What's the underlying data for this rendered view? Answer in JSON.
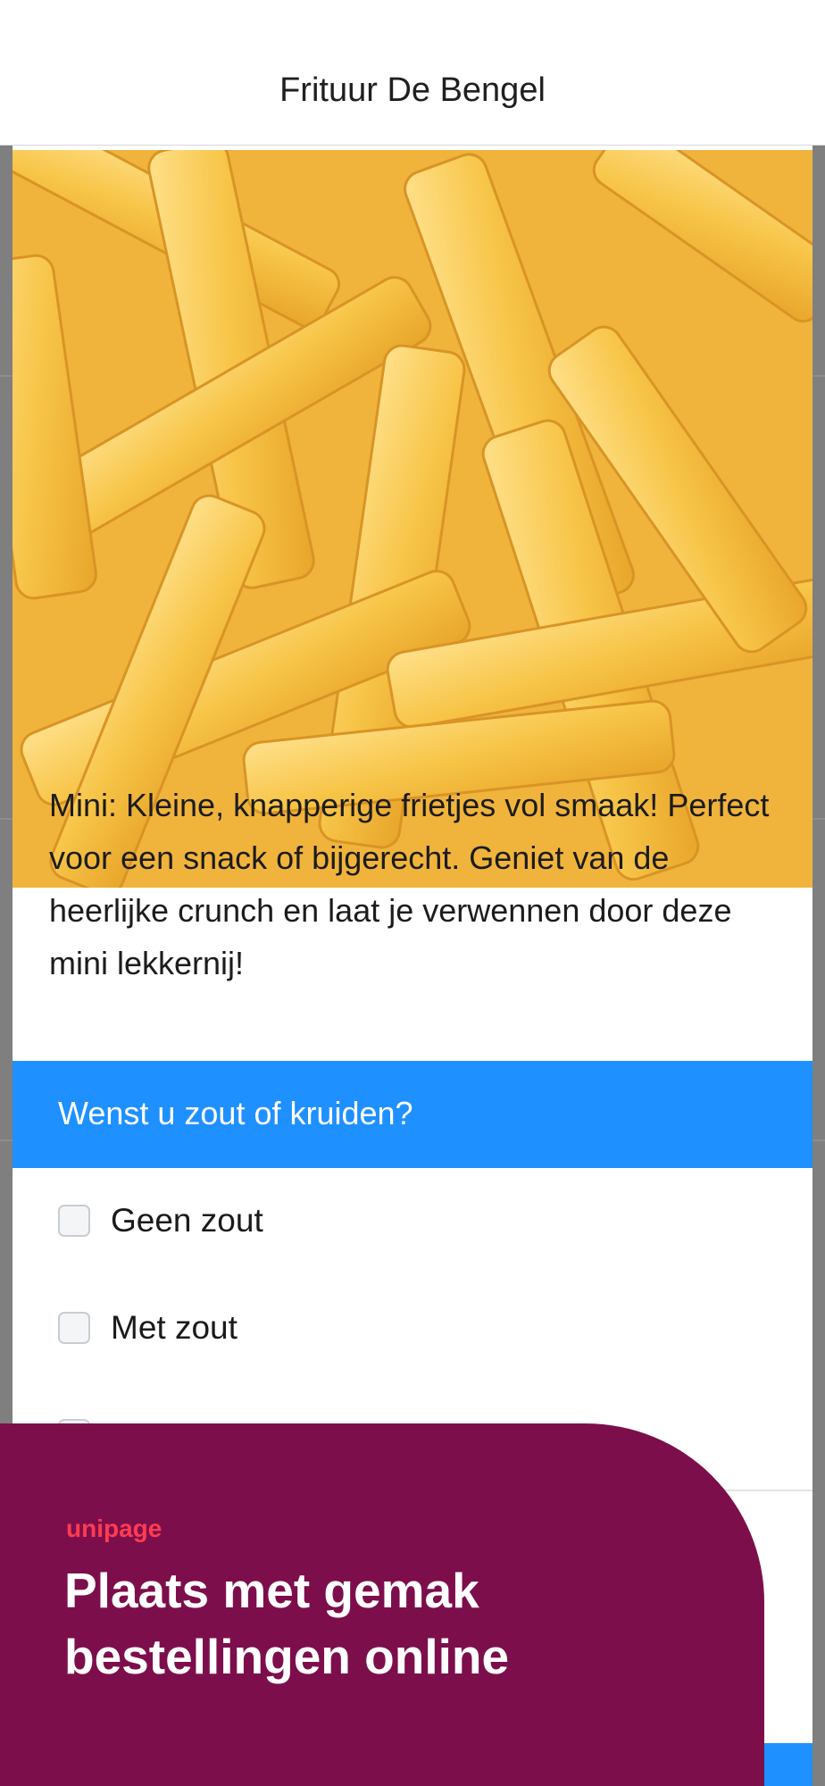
{
  "header": {
    "title": "Frituur De Bengel"
  },
  "product": {
    "image_alt": "fries-photo",
    "description": "Mini: Kleine, knapperige frietjes vol smaak! Perfect voor een snack of bijgerecht. Geniet van de heerlijke crunch en laat je verwennen door deze mini lekkernij!"
  },
  "options": {
    "question": "Wenst u zout of kruiden?",
    "items": [
      {
        "label": "Geen zout",
        "checked": false
      },
      {
        "label": "Met zout",
        "checked": false
      }
    ]
  },
  "promo": {
    "brand": "unipage",
    "title": "Plaats met gemak bestellingen online",
    "background": "#7d0e4c",
    "brand_color": "#ff3b53"
  },
  "colors": {
    "accent": "#1e90ff"
  }
}
